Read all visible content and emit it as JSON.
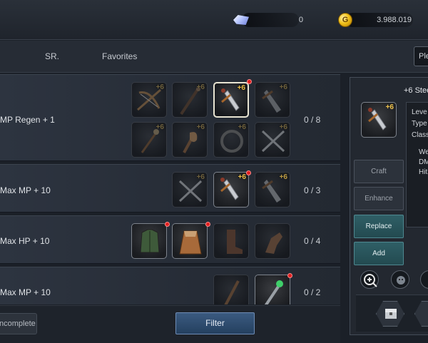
{
  "currencies": [
    {
      "name": "crystal-icon",
      "amount": "0"
    },
    {
      "name": "gold-coin-icon",
      "amount": "3.988.019",
      "coin_glyph": "G"
    }
  ],
  "tabs": [
    "SR.",
    "Favorites"
  ],
  "search": {
    "value": "Ple"
  },
  "rows": [
    {
      "stat": "MP Regen + 1",
      "count": "0 / 8"
    },
    {
      "stat": "Max MP + 10",
      "count": "0 / 3"
    },
    {
      "stat": "Max HP + 10",
      "count": "0 / 4"
    },
    {
      "stat": "Max MP + 10",
      "count": "0 / 2"
    }
  ],
  "enhance_tag": "+6",
  "bottom": {
    "incomplete_label": "ncomplete",
    "filter_label": "Filter"
  },
  "detail": {
    "title": "+6 Stee",
    "enhance_tag": "+6",
    "info": [
      "Leve",
      "Type",
      "Class",
      "We",
      "DM",
      "Hit"
    ],
    "actions": {
      "craft": "Craft",
      "enhance": "Enhance",
      "replace": "Replace",
      "add": "Add"
    }
  }
}
